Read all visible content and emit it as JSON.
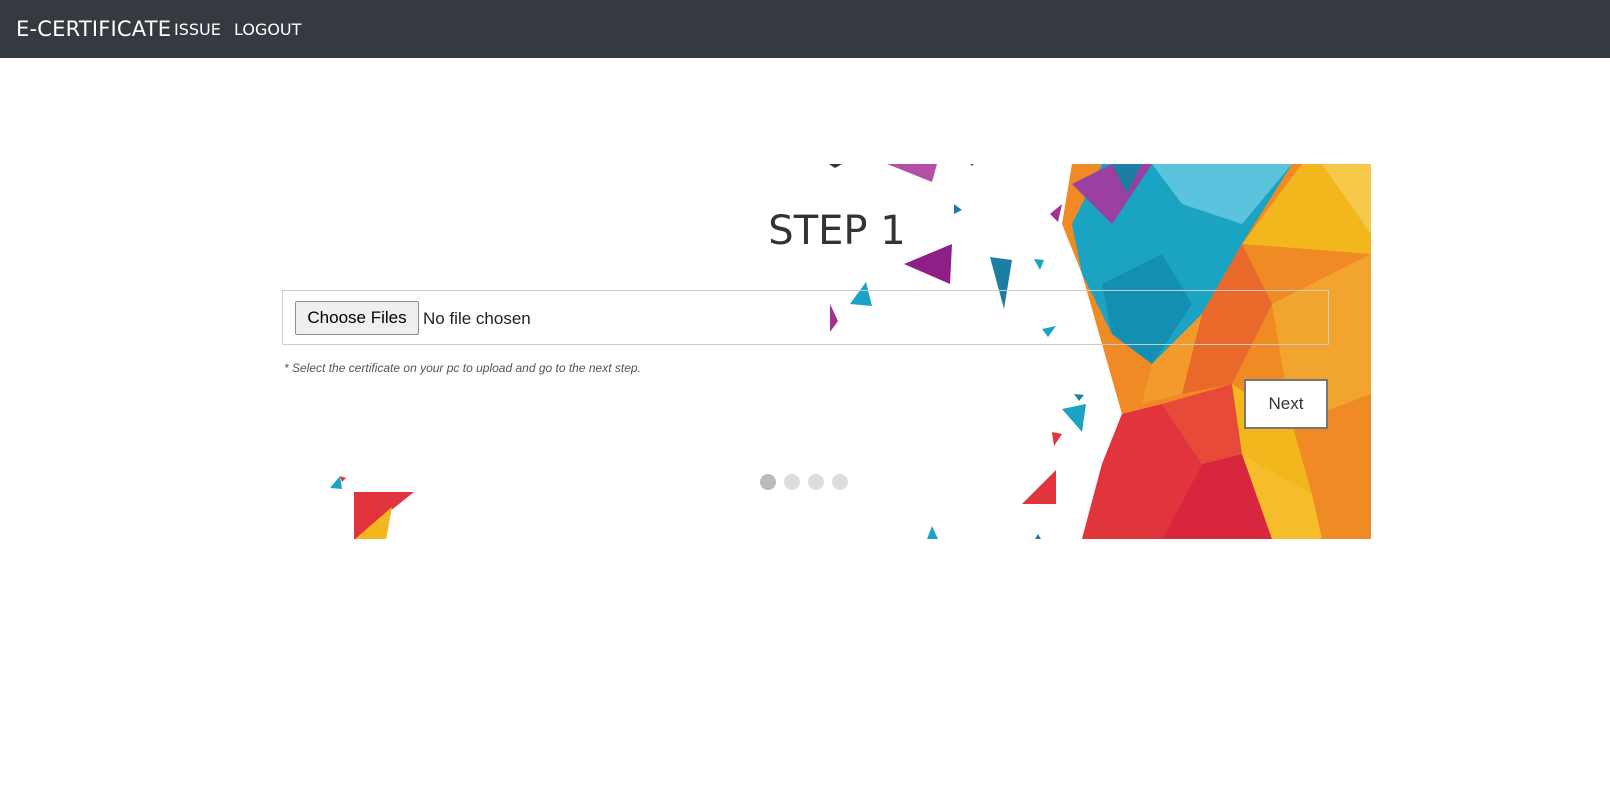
{
  "navbar": {
    "brand": "E-CERTIFICATE",
    "links": [
      {
        "label": "ISSUE"
      },
      {
        "label": "LOGOUT"
      }
    ],
    "background": "#343a40"
  },
  "step": {
    "title": "STEP 1",
    "file_button_label": "Choose Files",
    "file_status": "No file chosen",
    "hint": "* Select the certificate on your pc to upload and go to the next step.",
    "next_label": "Next",
    "progress": {
      "current": 1,
      "total": 4
    }
  },
  "colors": {
    "teal": "#1aa3c2",
    "orange": "#f08a24",
    "yellow": "#f3b71e",
    "red": "#e2343d",
    "purple": "#8e1f86"
  }
}
